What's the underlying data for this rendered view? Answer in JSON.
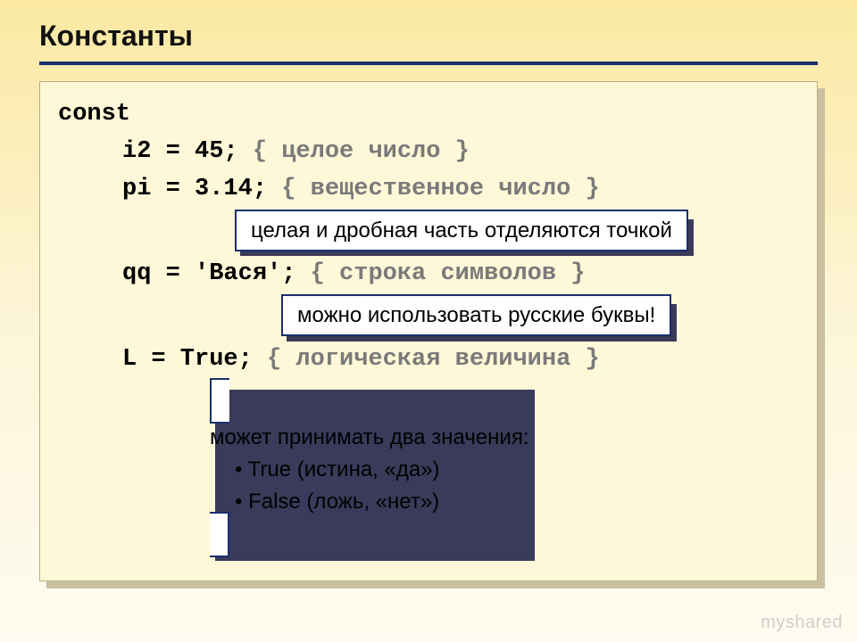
{
  "heading": "Константы",
  "code": {
    "kw_const": "const",
    "line_i2_code": "i2 = 45;",
    "line_i2_cmt": "{ целое число }",
    "line_pi_code": "pi = 3.14;",
    "line_pi_cmt": "{ вещественное число }",
    "line_qq_code": "qq = 'Вася';",
    "line_qq_cmt": "{ строка символов }",
    "line_l_code": "L  = True;",
    "line_l_cmt": "{ логическая величина }"
  },
  "notes": {
    "decimal": "целая и дробная часть отделяются точкой",
    "russian": "можно использовать русские буквы!",
    "bool_intro": "может принимать два значения:",
    "bool_true": "True (истина, «да»)",
    "bool_false": "False (ложь, «нет»)"
  },
  "watermark": "myshared"
}
